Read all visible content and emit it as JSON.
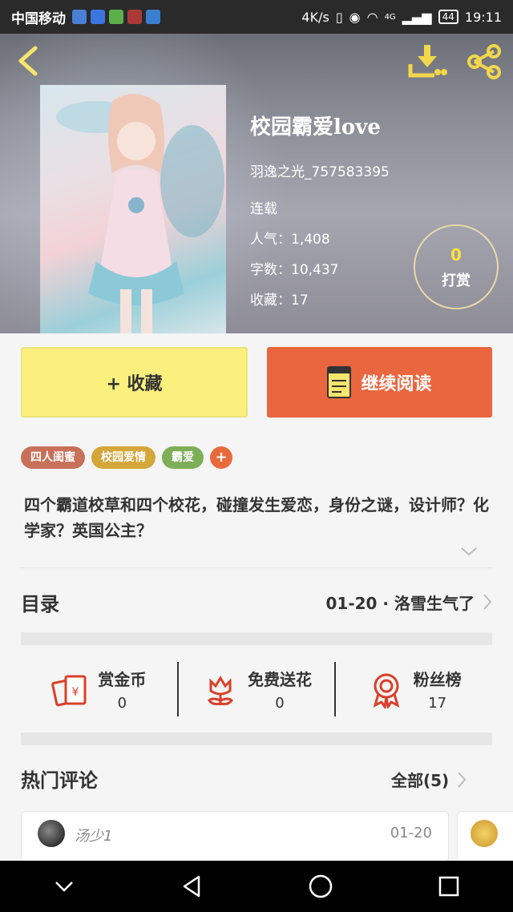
{
  "status_bar": {
    "carrier": "中国移动",
    "speed": "4K/s",
    "network": "4G",
    "battery": "44",
    "time": "19:11"
  },
  "hero": {
    "title": "校园霸爱love",
    "author": "羽逸之光_757583395",
    "status": "连载",
    "popularity": "人气：1,408",
    "word_count": "字数：10,437",
    "favorites": "收藏：17",
    "tip_count": "0",
    "tip_label": "打赏"
  },
  "actions": {
    "collect_label": "+ 收藏",
    "read_label": "继续阅读"
  },
  "tags": [
    {
      "label": "四人闺蜜",
      "color": "#c8705a"
    },
    {
      "label": "校园爱情",
      "color": "#d5a63a"
    },
    {
      "label": "霸爱",
      "color": "#7eaf58"
    }
  ],
  "tag_add": "+",
  "description": "四个霸道校草和四个校花，碰撞发生爱恋，身份之谜，设计师？化学家？英国公主？",
  "toc": {
    "title": "目录",
    "latest": "01-20 · 洛雪生气了"
  },
  "stats": [
    {
      "label": "赏金币",
      "value": "0",
      "icon": "red-envelope-icon"
    },
    {
      "label": "免费送花",
      "value": "0",
      "icon": "flower-icon"
    },
    {
      "label": "粉丝榜",
      "value": "17",
      "icon": "medal-icon"
    }
  ],
  "comments_section": {
    "title": "热门评论",
    "all_label": "全部(5)"
  },
  "comments": [
    {
      "user": "汤少1",
      "date": "01-20"
    }
  ],
  "colors": {
    "accent_orange": "#e9663f",
    "collect_yellow": "#fbf07e",
    "icon_red": "#d9402a",
    "icon_yellow": "#f2d64b"
  }
}
